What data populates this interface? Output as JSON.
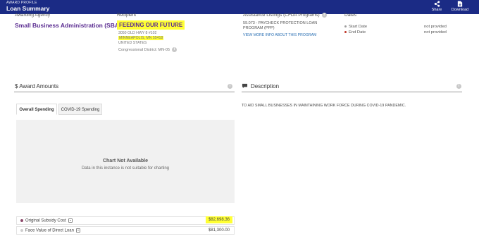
{
  "header": {
    "eyebrow": "AWARD PROFILE",
    "title": "Loan Summary",
    "share_label": "Share",
    "download_label": "Download"
  },
  "columns": {
    "agency_label": "Awarding Agency",
    "recipient_label": "Recipient",
    "cfda_label": "Assistance Listings (CFDA Programs)",
    "dates_label": "Dates"
  },
  "agency": {
    "name": "Small Business Administration (SBA)"
  },
  "recipient": {
    "name": "FEEDING OUR FUTURE",
    "address_line1": "3050 OLD HWY 8 #102",
    "address_line2": "MINNEAPOLIS, MN 55418",
    "address_line3": "UNITED STATES",
    "congressional_district": "Congressional District: MN-05"
  },
  "cfda": {
    "program": "59.073 - PAYCHECK PROTECTION LOAN PROGRAM (PPP)",
    "link": "VIEW MORE INFO ABOUT THIS PROGRAM"
  },
  "dates": {
    "start_label": "Start Date",
    "start_value": "not provided",
    "end_label": "End Date",
    "end_value": "not provided",
    "start_dot_color": "#9e9e9e",
    "end_dot_color": "#c0392b"
  },
  "award_amounts": {
    "title": "$ Award Amounts",
    "tabs": [
      "Overall Spending",
      "COVID-19 Spending"
    ],
    "chart_title": "Chart Not Available",
    "chart_message": "Data in this instance is not suitable for charting",
    "rows": [
      {
        "label": "Original Subsidy Cost",
        "value": "$82,698.36"
      },
      {
        "label": "Face Value of Direct Loan",
        "value": "$81,300.00"
      }
    ]
  },
  "description": {
    "title": "Description",
    "text": "TO AID SMALL BUSINESSES IN MAINTAINING WORK FORCE DURING COVID-19 PANDEMIC."
  },
  "colors": {
    "header_bg": "#1b2b85",
    "accent_purple": "#5b2d91",
    "highlight": "#ffff33",
    "link_blue": "#2a6fb3"
  }
}
